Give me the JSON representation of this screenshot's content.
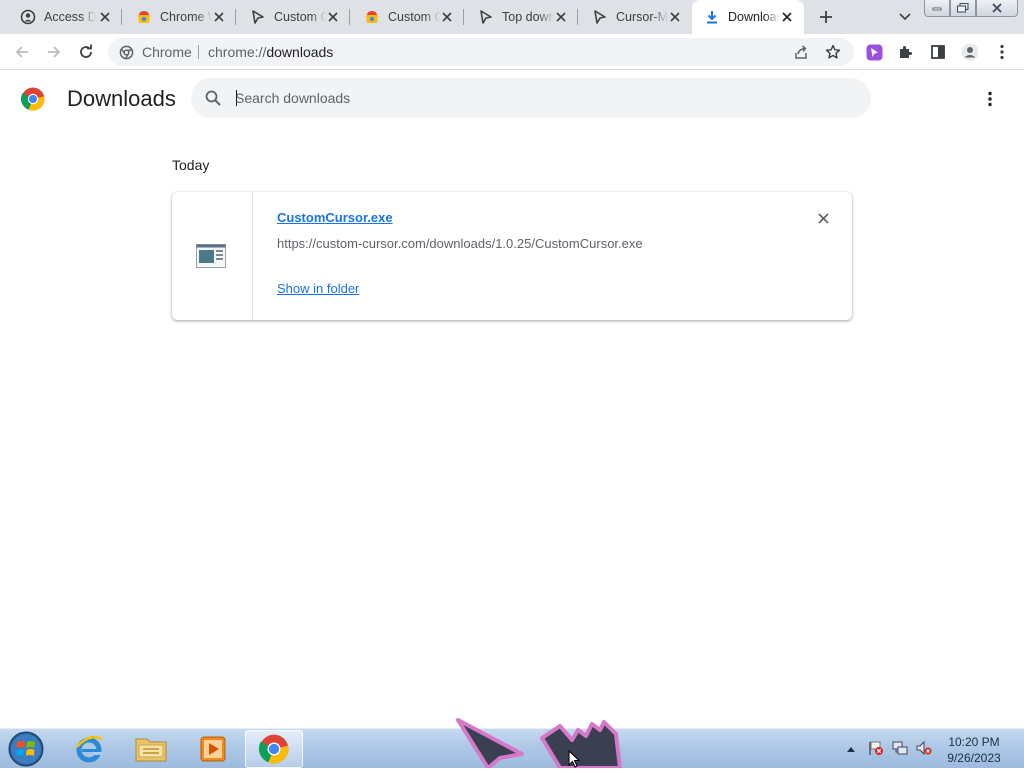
{
  "tabs": [
    {
      "title": "Access Denied",
      "icon": "shield-tab-icon"
    },
    {
      "title": "Chrome Web Store",
      "icon": "web-store-icon"
    },
    {
      "title": "Custom Cursor",
      "icon": "cursor-arrow-icon"
    },
    {
      "title": "Custom Cursor",
      "icon": "web-store-icon"
    },
    {
      "title": "Top downloads",
      "icon": "cursor-arrow-icon"
    },
    {
      "title": "Cursor-Mania",
      "icon": "cursor-arrow-icon"
    },
    {
      "title": "Downloads",
      "icon": "download-icon",
      "active": true
    }
  ],
  "omnibox": {
    "chip": "Chrome",
    "scheme": "chrome://",
    "host": "downloads"
  },
  "page": {
    "title": "Downloads",
    "search_placeholder": "Search downloads",
    "section_label": "Today"
  },
  "downloads": [
    {
      "file_name": "CustomCursor.exe",
      "url": "https://custom-cursor.com/downloads/1.0.25/CustomCursor.exe",
      "action": "Show in folder"
    }
  ],
  "taskbar": {
    "time": "10:20 PM",
    "date": "9/26/2023",
    "apps": [
      "internet-explorer-icon",
      "file-explorer-icon",
      "media-player-icon",
      "chrome-icon"
    ]
  },
  "colors": {
    "accent": "#1a73e8",
    "tabstrip": "#dee1e6",
    "omnibox": "#f1f3f4"
  }
}
